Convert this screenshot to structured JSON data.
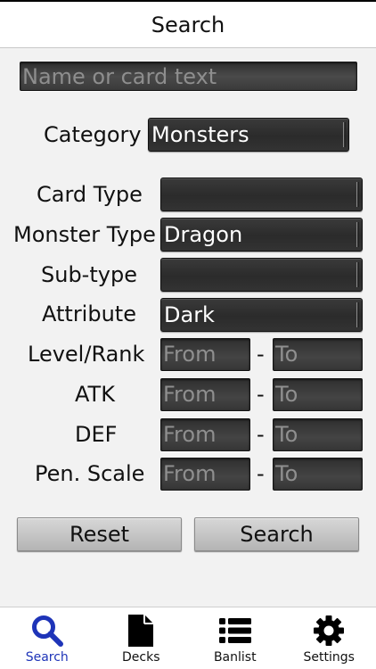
{
  "header": {
    "title": "Search"
  },
  "search": {
    "placeholder": "Name or card text"
  },
  "category": {
    "label": "Category",
    "value": "Monsters"
  },
  "filters": {
    "card_type": {
      "label": "Card Type",
      "value": ""
    },
    "monster_type": {
      "label": "Monster Type",
      "value": "Dragon"
    },
    "sub_type": {
      "label": "Sub-type",
      "value": ""
    },
    "attribute": {
      "label": "Attribute",
      "value": "Dark"
    }
  },
  "ranges": {
    "level_rank": {
      "label": "Level/Rank",
      "from": "From",
      "to": "To"
    },
    "atk": {
      "label": "ATK",
      "from": "From",
      "to": "To"
    },
    "def": {
      "label": "DEF",
      "from": "From",
      "to": "To"
    },
    "pen_scale": {
      "label": "Pen. Scale",
      "from": "From",
      "to": "To"
    },
    "separator": "-"
  },
  "actions": {
    "reset": "Reset",
    "search": "Search"
  },
  "tabs": [
    {
      "label": "Search",
      "icon": "search-icon",
      "active": true
    },
    {
      "label": "Decks",
      "icon": "document-icon",
      "active": false
    },
    {
      "label": "Banlist",
      "icon": "list-icon",
      "active": false
    },
    {
      "label": "Settings",
      "icon": "gear-icon",
      "active": false
    }
  ],
  "colors": {
    "accent": "#1e34b8",
    "control_bg": "#333333",
    "button_bg": "#c4c4c4"
  }
}
